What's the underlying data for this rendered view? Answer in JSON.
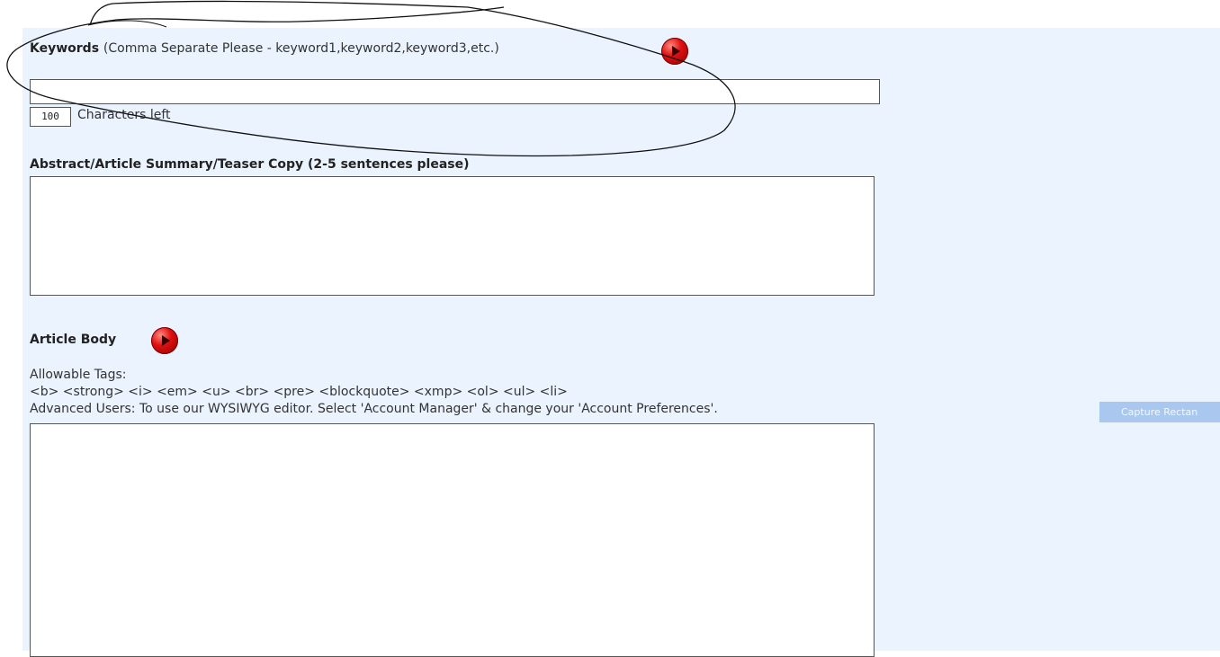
{
  "keywords": {
    "label": "Keywords",
    "hint": "(Comma Separate Please - keyword1,keyword2,keyword3,etc.)",
    "value": "",
    "counter": "100",
    "counter_suffix": "Characters left"
  },
  "abstract": {
    "label": "Abstract/Article Summary/Teaser Copy (2-5 sentences please)",
    "value": ""
  },
  "article_body": {
    "label": "Article Body",
    "allowable_label": "Allowable Tags:",
    "allowable_tags": "<b> <strong> <i> <em> <u> <br> <pre> <blockquote> <xmp> <ol> <ul> <li>",
    "advanced_note": "Advanced Users: To use our WYSIWYG editor. Select 'Account Manager' & change your 'Account Preferences'.",
    "value": ""
  },
  "capture_button": "Capture Rectan",
  "icons": {
    "help_button": "red-play-icon"
  },
  "colors": {
    "panel_bg": "#eaf3fe",
    "help_red": "#e01010"
  }
}
